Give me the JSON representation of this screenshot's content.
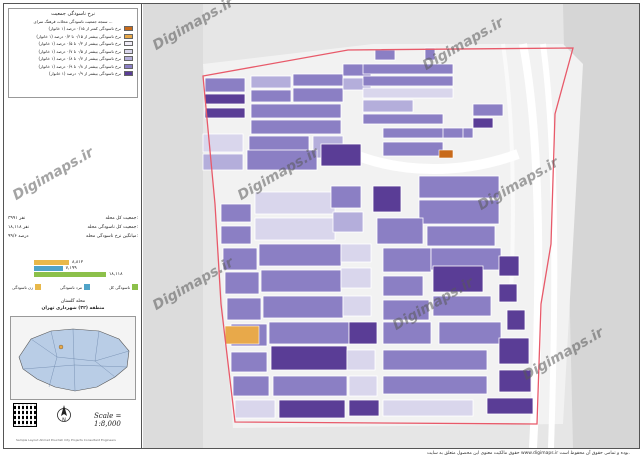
{
  "legend": {
    "title_line1": "نرخ ناسودگی جمعیت",
    "title_line2": "سنجه جمعیت ناسودگی محلات فرهنگ سرای ...",
    "classes": [
      {
        "label": "نرخ ناسودگی کمتر از ۰/۱۵ درصد (۱ خانوار)",
        "color": "#c86a1a"
      },
      {
        "label": "نرخ ناسودگی بیشتر از ۰/۱۵ تا ۰/۳ درصد (۱ خانوار)",
        "color": "#e8a94a"
      },
      {
        "label": "نرخ ناسودگی بیشتر از ۰/۳ تا ۰/۵ درصد (۱ خانوار)",
        "color": "#f0ecf7"
      },
      {
        "label": "نرخ ناسودگی بیشتر از ۰/۵ تا ۰/۷ درصد (۱ خانوار)",
        "color": "#d9d6ec"
      },
      {
        "label": "نرخ ناسودگی بیشتر از ۰/۷ تا ۰/۸ درصد (۱ خانوار)",
        "color": "#b4aedb"
      },
      {
        "label": "نرخ ناسودگی بیشتر از ۰/۸ تا ۰/۹ درصد (۱ خانوار)",
        "color": "#8b7fc4"
      },
      {
        "label": "نرخ ناسودگی بیشتر از ۰/۹ درصد (۱ خانوار)",
        "color": "#5a3d96"
      }
    ]
  },
  "stats": [
    {
      "label": "جمعیت کل محله:",
      "value": "۳۹۹۱ نفر"
    },
    {
      "label": "جمعیت کل ناسودگی محله:",
      "value": "۱۸,۱۱۸ نفر"
    },
    {
      "label": "میانگین نرخ ناسودگی محله:",
      "value": "۹۹/۶ درصد"
    }
  ],
  "bar_chart": {
    "values": [
      {
        "value": 8812,
        "label": "۸,۸۱۲",
        "color": "#e8b84a"
      },
      {
        "value": 7199,
        "label": "۷,۱۹۹",
        "color": "#4fa3c8"
      },
      {
        "value": 18118,
        "label": "۱۸,۱۱۸",
        "color": "#8cc04a"
      }
    ],
    "keys": [
      {
        "label": "زن ناسودگی",
        "color": "#e8b84a"
      },
      {
        "label": "مرد ناسودگی",
        "color": "#4fa3c8"
      },
      {
        "label": "ناسودگی کل",
        "color": "#8cc04a"
      }
    ]
  },
  "region": {
    "line1": "محله گلستان",
    "line2": "منطقه (۳۲) شهرداری تهران"
  },
  "scale": "Scale = 1:8,000",
  "north_label": "N",
  "footer_credit": "Sample Layout Ahmad Pourdeh City Projects Consultant Engineers",
  "watermarks": [
    "Digimaps.ir",
    "Digimaps.ir",
    "Digimaps.ir",
    "Digimaps.ir",
    "Digimaps.ir",
    "Digimaps.ir",
    "Digimaps.ir",
    "Digimaps.ir"
  ],
  "copyright": "حقوق مالکیت معنوی این محصول متعلق به سایت www.digimaps.ir بوده و تمامی حقوق آن محفوظ است.",
  "colors": {
    "boundary": "#e85a6a",
    "road": "#f8f8f8",
    "background": "#ededed"
  }
}
